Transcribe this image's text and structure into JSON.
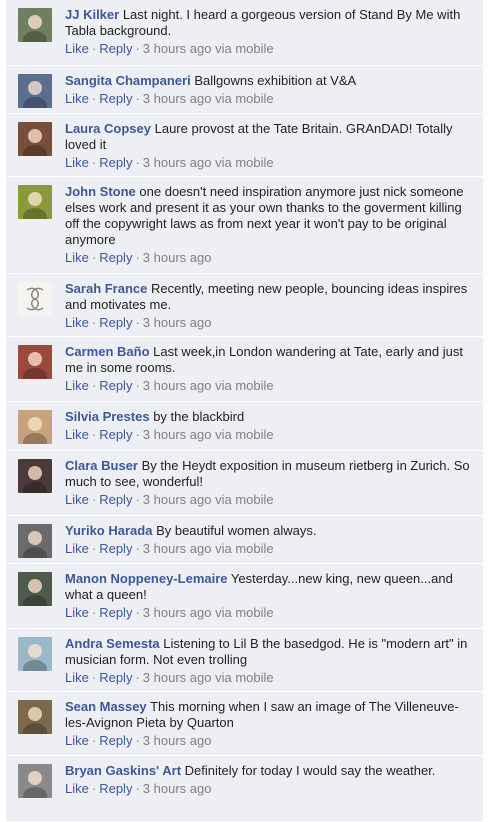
{
  "comments": [
    {
      "author": "JJ Kilker",
      "text": "Last night. I heard a gorgeous version of Stand By Me with Tabla background.",
      "like": "Like",
      "reply": "Reply",
      "time": "3 hours ago",
      "via": "via mobile",
      "avatar_color": "#6f7f5f"
    },
    {
      "author": "Sangita Champaneri",
      "text": "Ballgowns exhibition at V&A",
      "like": "Like",
      "reply": "Reply",
      "time": "3 hours ago",
      "via": "via mobile",
      "avatar_color": "#5a6f8f"
    },
    {
      "author": "Laura Copsey",
      "text": "Laure provost at the Tate Britain. GRAnDAD! Totally loved it",
      "like": "Like",
      "reply": "Reply",
      "time": "3 hours ago",
      "via": "via mobile",
      "avatar_color": "#7a4f3a"
    },
    {
      "author": "John Stone",
      "text": "one doesn't need inspiration anymore just nick someone elses work and present it as your own thanks to the goverment killing off the copywright laws as from next year it won't pay to be original anymore",
      "like": "Like",
      "reply": "Reply",
      "time": "3 hours ago",
      "via": "",
      "avatar_color": "#8a9a3a"
    },
    {
      "author": "Sarah France",
      "text": "Recently, meeting new people, bouncing ideas inspires and motivates me.",
      "like": "Like",
      "reply": "Reply",
      "time": "3 hours ago",
      "via": "",
      "avatar_color": "#b9b0a6"
    },
    {
      "author": "Carmen Baño",
      "text": "Last week,in London wandering at Tate, early and just me in some rooms.",
      "like": "Like",
      "reply": "Reply",
      "time": "3 hours ago",
      "via": "via mobile",
      "avatar_color": "#9a4a3a"
    },
    {
      "author": "Silvia Prestes",
      "text": "by the blackbird",
      "like": "Like",
      "reply": "Reply",
      "time": "3 hours ago",
      "via": "via mobile",
      "avatar_color": "#c8a27a"
    },
    {
      "author": "Clara Buser",
      "text": "By the Heydt exposition in museum rietberg in Zurich. So much to see, wonderful!",
      "like": "Like",
      "reply": "Reply",
      "time": "3 hours ago",
      "via": "via mobile",
      "avatar_color": "#4a3a3a"
    },
    {
      "author": "Yuriko Harada",
      "text": "By beautiful women always.",
      "like": "Like",
      "reply": "Reply",
      "time": "3 hours ago",
      "via": "via mobile",
      "avatar_color": "#6a6a6a"
    },
    {
      "author": "Manon Noppeney-Lemaire",
      "text": "Yesterday...new king, new queen...and what a queen!",
      "like": "Like",
      "reply": "Reply",
      "time": "3 hours ago",
      "via": "via mobile",
      "avatar_color": "#4f5a4a"
    },
    {
      "author": "Andra Semesta",
      "text": "Listening to Lil B the basedgod. He is \"modern art\" in musician form. Not even trolling",
      "like": "Like",
      "reply": "Reply",
      "time": "3 hours ago",
      "via": "via mobile",
      "avatar_color": "#9ab8c8"
    },
    {
      "author": "Sean Massey",
      "text": "This morning when I saw an image of The Villeneuve-les-Avignon Pieta by Quarton",
      "like": "Like",
      "reply": "Reply",
      "time": "3 hours ago",
      "via": "",
      "avatar_color": "#7a6a4a"
    },
    {
      "author": "Bryan Gaskins' Art",
      "text": "Definitely for today I would say the weather.",
      "like": "Like",
      "reply": "Reply",
      "time": "3 hours ago",
      "via": "",
      "avatar_color": "#8a8a8a"
    }
  ]
}
